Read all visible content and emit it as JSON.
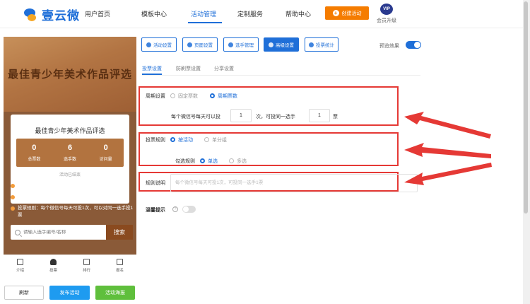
{
  "header": {
    "logo_text": "壹云微",
    "nav": [
      "用户首页",
      "模板中心",
      "活动管理",
      "定制服务",
      "帮助中心"
    ],
    "active_nav": "活动管理",
    "create_button": "创建活动",
    "vip_badge": "VIP",
    "upgrade_label": "会员升级"
  },
  "preview": {
    "banner_title": "最佳青少年美术作品评选",
    "card_title": "最佳青少年美术作品评选",
    "stats": [
      {
        "value": "0",
        "label": "总票数"
      },
      {
        "value": "6",
        "label": "选手数"
      },
      {
        "value": "0",
        "label": "访问量"
      }
    ],
    "status": "活动已结束",
    "info": [
      "投票开始：2025-01-16 15:03:49",
      "投票截止：2025-01-22 15:03:49",
      "投票规则：每个微信号每天可投1次，可以对同一选手投1票"
    ],
    "search_placeholder": "请输入选手编号/名称",
    "search_button": "搜索",
    "tabs": [
      "介绍",
      "投票",
      "排行",
      "报名"
    ]
  },
  "actions": {
    "refresh": "刷新",
    "publish": "发布活动",
    "qrcode": "活动海报"
  },
  "toolbar": {
    "buttons": [
      "活动设置",
      "页面设置",
      "选手管理",
      "高级设置",
      "投票统计"
    ],
    "active": "高级设置",
    "preview_toggle_label": "预览效果"
  },
  "subtabs": {
    "items": [
      "投票设置",
      "防刷票设置",
      "分享设置"
    ],
    "active": "投票设置"
  },
  "cycle_setting": {
    "label": "周期设置",
    "options": [
      "固定票数",
      "周期票数"
    ],
    "selected": "周期票数",
    "rule_prefix": "每个微信号每天可以投",
    "daily_votes": "1",
    "rule_middle": "次，可投同一选手",
    "same_player_votes": "1",
    "rule_suffix": "票"
  },
  "vote_rule": {
    "label": "投票规则",
    "options": [
      "按活动",
      "单分组"
    ],
    "selected": "按活动",
    "check_label": "勾选规则",
    "check_options": [
      "单选",
      "多选"
    ],
    "check_selected": "单选"
  },
  "rule_desc": {
    "label": "规则说明",
    "placeholder": "每个微信号每天可投1次，可投同一选手1票"
  },
  "reminder": {
    "label": "温馨提示",
    "help": "?"
  },
  "colors": {
    "primary": "#1f6fd8",
    "orange": "#f57c00",
    "highlight": "#e53935",
    "preview_bg": "#8a5a38"
  }
}
